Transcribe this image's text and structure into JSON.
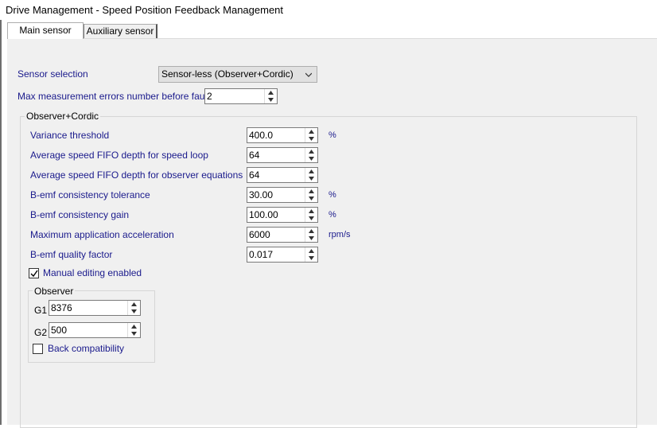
{
  "window": {
    "title": "Drive Management - Speed Position Feedback Management"
  },
  "tabs": [
    {
      "label": "Main sensor",
      "active": true
    },
    {
      "label": "Auxiliary sensor",
      "active": false
    }
  ],
  "sensor_selection": {
    "label": "Sensor selection",
    "value": "Sensor-less (Observer+Cordic)"
  },
  "max_errors": {
    "label": "Max measurement errors number before fault",
    "value": "2"
  },
  "observer_cordic": {
    "title": "Observer+Cordic",
    "fields": [
      {
        "label": "Variance threshold",
        "value": "400.0",
        "unit": "%"
      },
      {
        "label": "Average speed FIFO depth for speed loop",
        "value": "64",
        "unit": ""
      },
      {
        "label": "Average speed FIFO depth for observer equations",
        "value": "64",
        "unit": ""
      },
      {
        "label": "B-emf consistency tolerance",
        "value": "30.00",
        "unit": "%"
      },
      {
        "label": "B-emf consistency gain",
        "value": "100.00",
        "unit": "%"
      },
      {
        "label": "Maximum application acceleration",
        "value": "6000",
        "unit": "rpm/s"
      },
      {
        "label": "B-emf quality factor",
        "value": "0.017",
        "unit": ""
      }
    ],
    "manual_editing": {
      "label": "Manual editing enabled",
      "checked": true
    }
  },
  "observer": {
    "title": "Observer",
    "g1": {
      "label": "G1",
      "value": "8376"
    },
    "g2": {
      "label": "G2",
      "value": "500"
    },
    "back_compat": {
      "label": "Back compatibility",
      "checked": false
    }
  },
  "colors": {
    "label_blue": "#1a1a8c",
    "panel_bg": "#f0f0f0"
  },
  "icons": {
    "combo": "chevron-down-icon",
    "spin": "spin-arrows-icon",
    "check": "check-icon"
  }
}
